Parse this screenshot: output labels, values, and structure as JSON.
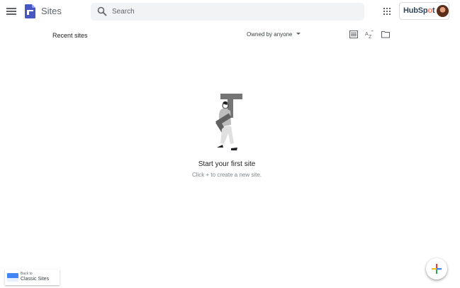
{
  "header": {
    "menu_icon": "hamburger-menu-icon",
    "app_icon": "google-sites-logo",
    "app_title": "Sites",
    "search": {
      "placeholder": "Search",
      "value": ""
    },
    "apps_icon": "google-apps-grid-icon",
    "account": {
      "brand_before": "HubSp",
      "brand_accent": "o",
      "brand_after": "t"
    }
  },
  "main": {
    "section_title": "Recent sites",
    "filter_label": "Owned by anyone",
    "view_icons": [
      "list-view-icon",
      "sort-az-icon",
      "folder-icon"
    ],
    "empty_state": {
      "title": "Start your first site",
      "hint": "Click + to create a new site."
    }
  },
  "footer": {
    "classic_small": "Back to",
    "classic_main": "Classic Sites",
    "fab_icon": "plus-icon"
  },
  "colors": {
    "blue": "#4285f4",
    "red": "#ea4335",
    "yellow": "#fbbc05",
    "green": "#34a853",
    "sites_purple": "#4758c3"
  }
}
